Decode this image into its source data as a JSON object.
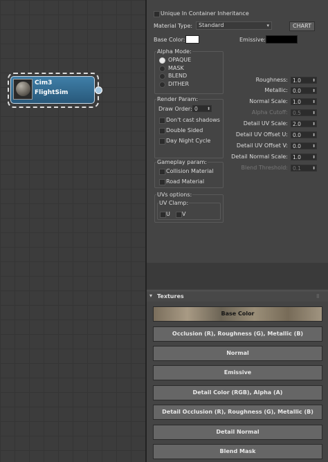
{
  "node": {
    "name_line1": "Cim3",
    "name_line2": "FlightSim"
  },
  "material": {
    "unique_label": "Unique In Container Inheritance",
    "type_label": "Material Type:",
    "type_value": "Standard",
    "chart_label": "CHART",
    "base_color_label": "Base Color:",
    "emissive_label": "Emissive:",
    "base_color": "#ffffff",
    "emissive_color": "#000000"
  },
  "alpha_mode": {
    "title": "Alpha Mode:",
    "options": [
      "OPAQUE",
      "MASK",
      "BLEND",
      "DITHER"
    ],
    "selected": "OPAQUE"
  },
  "render_param": {
    "title": "Render Param:",
    "draw_order_label": "Draw Order:",
    "draw_order_value": "0",
    "checks": [
      "Don't cast shadows",
      "Double Sided",
      "Day Night Cycle"
    ]
  },
  "gameplay_param": {
    "title": "Gameplay param:",
    "checks": [
      "Collision Material",
      "Road Material"
    ]
  },
  "uv_options": {
    "title": "UVs options:",
    "clamp_label": "UV Clamp:",
    "u_label": "U",
    "v_label": "V"
  },
  "params": [
    {
      "label": "Roughness:",
      "value": "1.0",
      "enabled": true
    },
    {
      "label": "Metallic:",
      "value": "0.0",
      "enabled": true
    },
    {
      "label": "Normal Scale:",
      "value": "1.0",
      "enabled": true
    },
    {
      "label": "Alpha Cutoff:",
      "value": "0.5",
      "enabled": false
    },
    {
      "label": "Detail UV Scale:",
      "value": "2.0",
      "enabled": true
    },
    {
      "label": "Detail UV Offset U:",
      "value": "0.0",
      "enabled": true
    },
    {
      "label": "Detail UV Offset V:",
      "value": "0.0",
      "enabled": true
    },
    {
      "label": "Detail Normal Scale:",
      "value": "1.0",
      "enabled": true
    },
    {
      "label": "Blend Threshold:",
      "value": "0.1",
      "enabled": false
    }
  ],
  "textures": {
    "title": "Textures",
    "collapse_icon": "triangle-down-icon",
    "buttons": [
      "Base Color",
      "Occlusion (R), Roughness (G), Metallic (B)",
      "Normal",
      "Emissive",
      "Detail Color (RGB), Alpha (A)",
      "Detail Occlusion (R), Roughness (G), Metallic (B)",
      "Detail Normal",
      "Blend Mask"
    ]
  }
}
